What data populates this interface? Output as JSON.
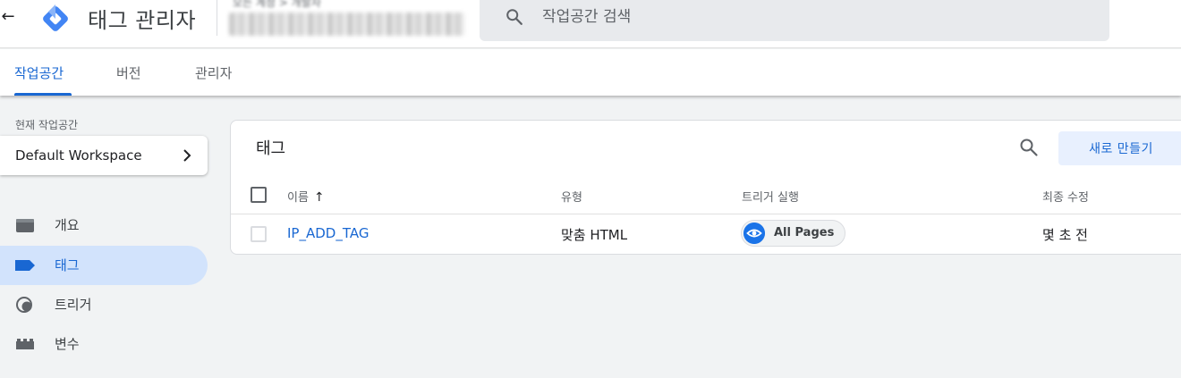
{
  "appbar": {
    "back_glyph": "←",
    "app_title": "태그 관리자",
    "account_crumb": "모든 계정 > 개발자",
    "search_placeholder": "작업공간 검색"
  },
  "tabs": [
    {
      "label": "작업공간",
      "active": true
    },
    {
      "label": "버전",
      "active": false
    },
    {
      "label": "관리자",
      "active": false
    }
  ],
  "sidebar": {
    "workspace_label": "현재 작업공간",
    "workspace_name": "Default Workspace",
    "items": [
      {
        "label": "개요",
        "icon": "folder-icon",
        "active": false
      },
      {
        "label": "태그",
        "icon": "tag-icon",
        "active": true
      },
      {
        "label": "트리거",
        "icon": "trigger-icon",
        "active": false
      },
      {
        "label": "변수",
        "icon": "variables-icon",
        "active": false
      }
    ]
  },
  "tags_card": {
    "title": "태그",
    "new_button": "새로 만들기",
    "columns": [
      "이름",
      "유형",
      "트리거 실행",
      "최종 수정"
    ],
    "sort_arrow": "↑",
    "rows": [
      {
        "name": "IP_ADD_TAG",
        "type": "맞춤 HTML",
        "trigger": "All Pages",
        "modified": "몇 초 전"
      }
    ]
  },
  "colors": {
    "accent": "#1967d2",
    "active_nav_bg": "#d2e3fc",
    "button_bg": "#e8f0fe",
    "page_bg": "#f1f3f4"
  }
}
